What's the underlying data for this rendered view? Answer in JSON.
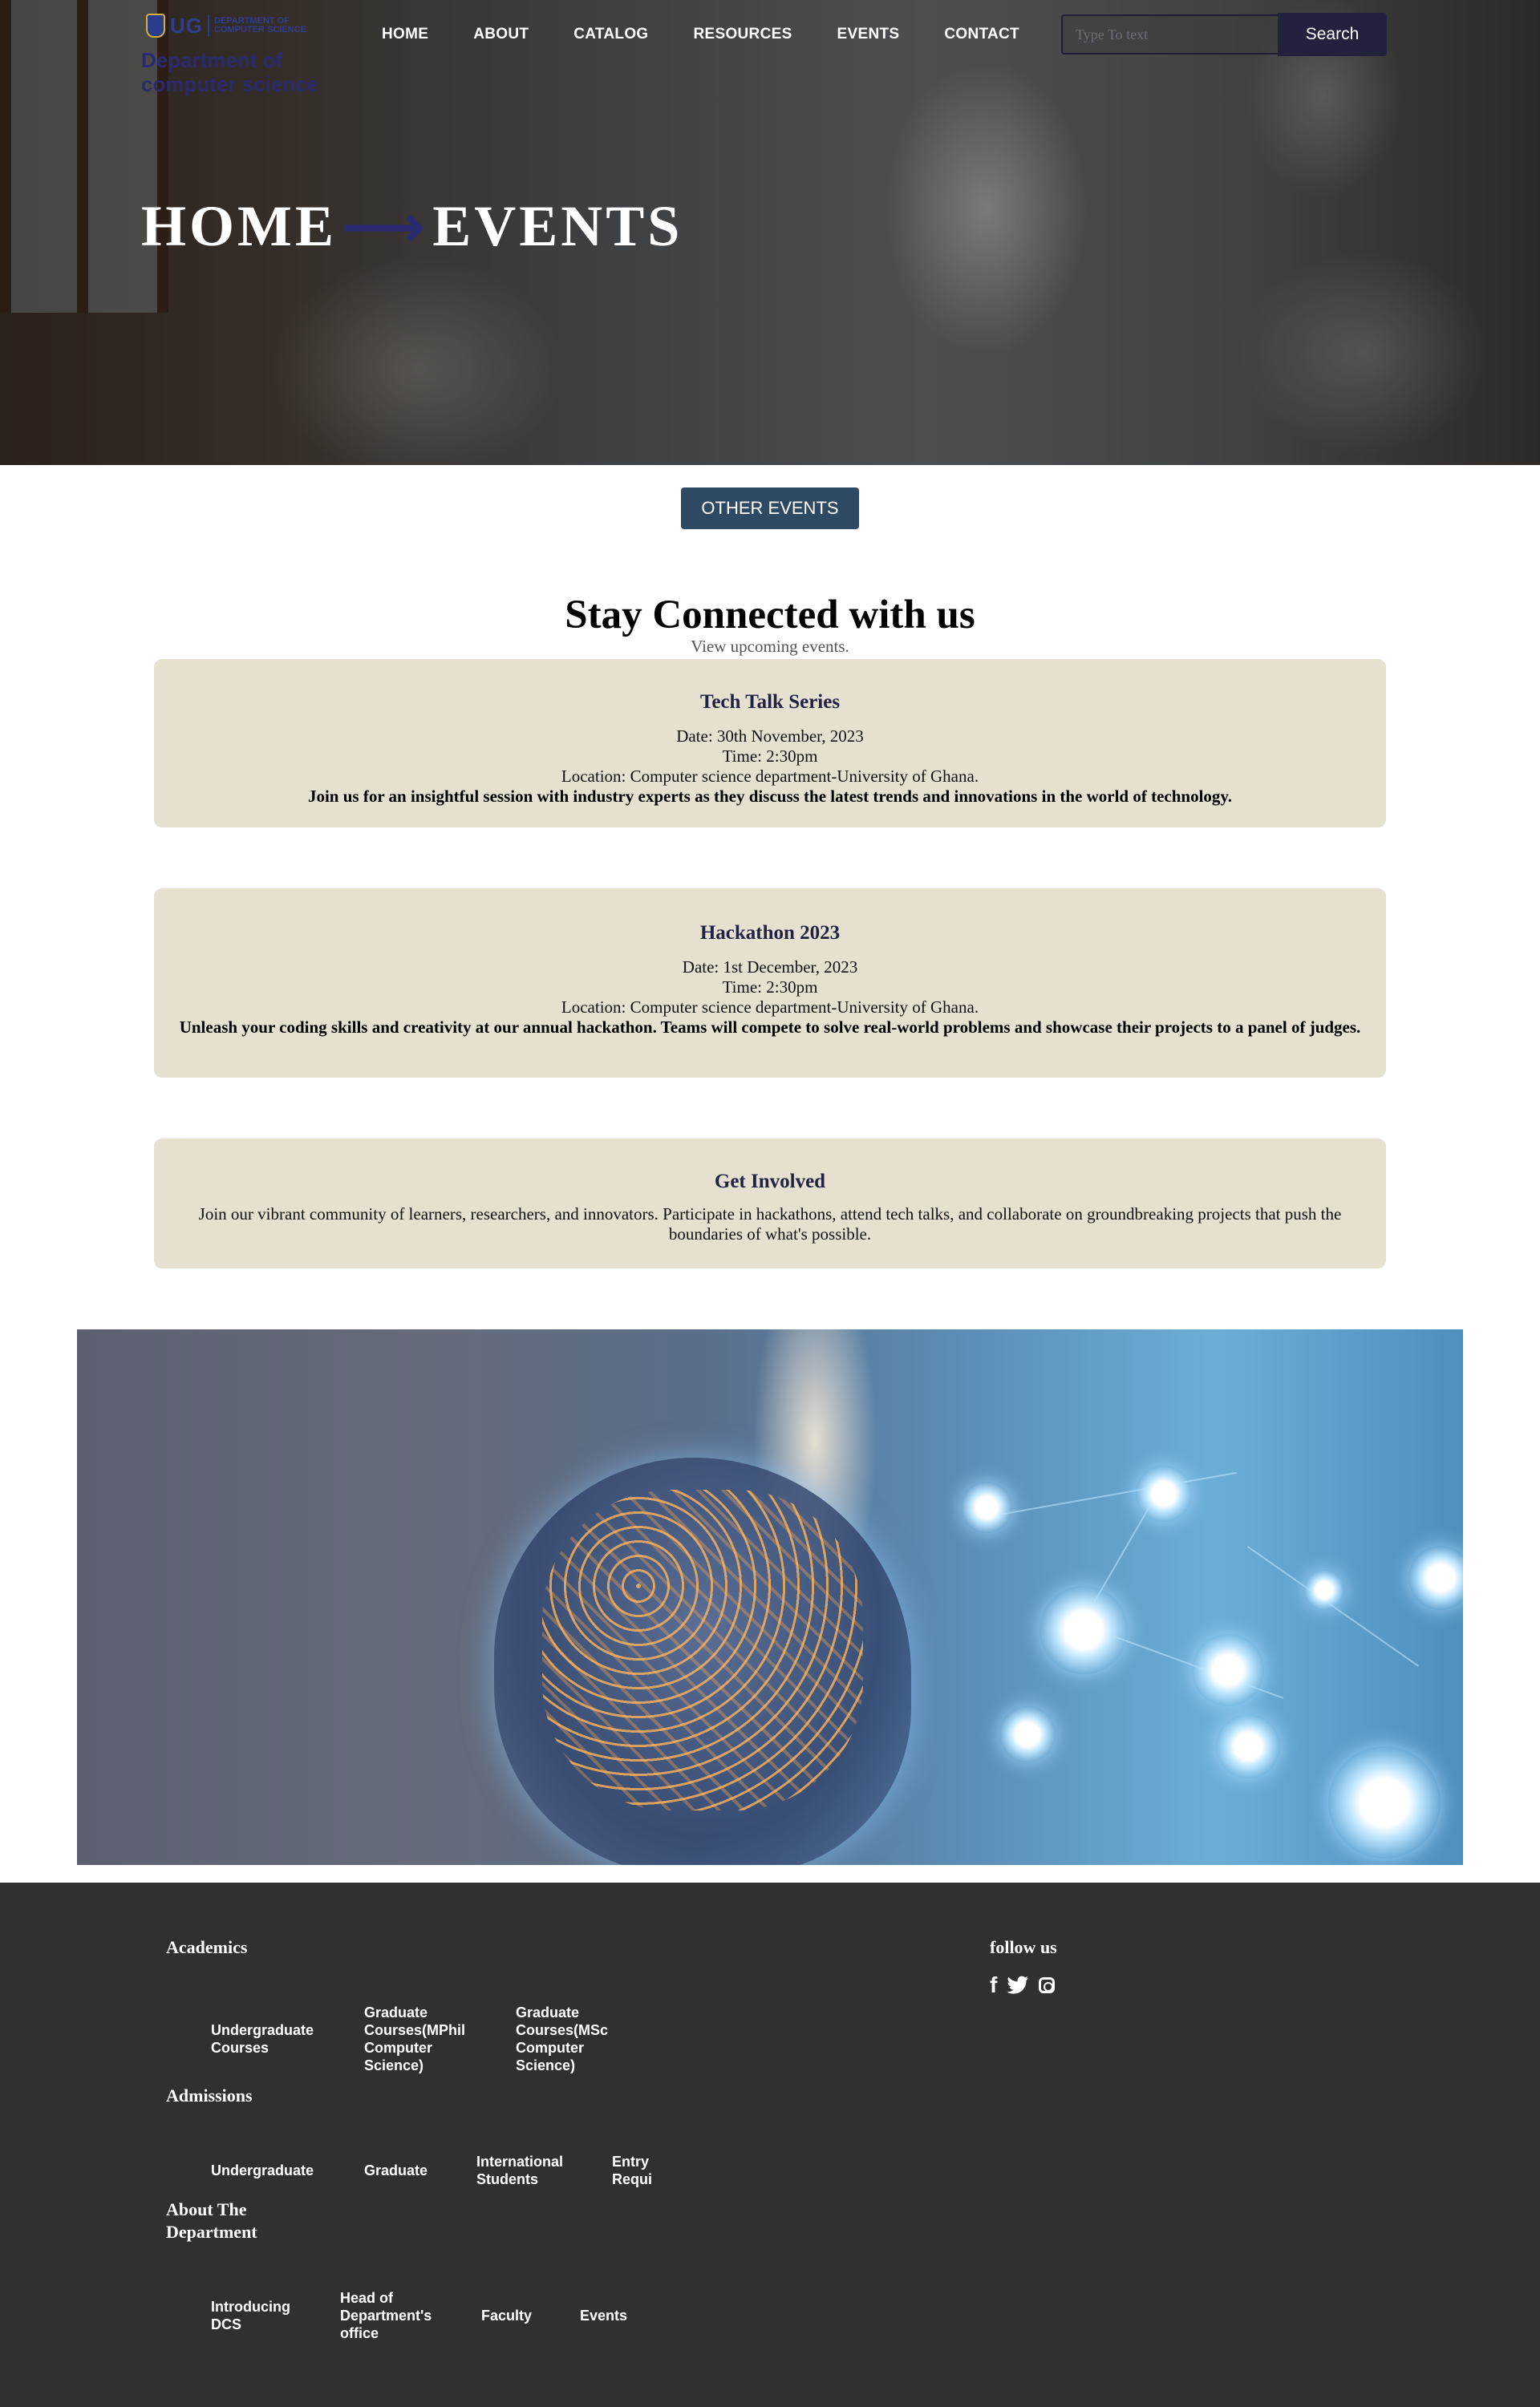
{
  "header": {
    "logo_short": "UG",
    "logo_text": "DEPARTMENT OF COMPUTER SCIENCE",
    "dept_name": "Department of computer science",
    "nav": [
      "HOME",
      "ABOUT",
      "CATALOG",
      "RESOURCES",
      "EVENTS",
      "CONTACT"
    ],
    "search": {
      "placeholder": "Type To text",
      "button": "Search"
    }
  },
  "hero": {
    "crumb_home": "HOME",
    "arrow": "⟶",
    "crumb_current": "EVENTS"
  },
  "other_events": "OTHER EVENTS",
  "connect": {
    "title": "Stay Connected with us",
    "subtitle": "View upcoming events."
  },
  "events": [
    {
      "title": "Tech Talk Series",
      "date": "Date: 30th November, 2023",
      "time": "Time: 2:30pm",
      "location": "Location: Computer science department-University of Ghana.",
      "description": "Join us for an insightful session with industry experts as they discuss the latest trends and innovations in the world of technology."
    },
    {
      "title": "Hackathon 2023",
      "date": "Date: 1st December, 2023",
      "time": "Time: 2:30pm",
      "location": "Location: Computer science department-University of Ghana.",
      "description": "Unleash your coding skills and creativity at our annual hackathon. Teams will compete to solve real-world problems and showcase their projects to a panel of judges."
    }
  ],
  "get_involved": {
    "title": "Get Involved",
    "text": "Join our vibrant community of learners, researchers, and innovators. Participate in hackathons, attend tech talks, and collaborate on groundbreaking projects that push the boundaries of what's possible."
  },
  "footer": {
    "academics": {
      "heading": "Academics",
      "links": [
        "Undergraduate Courses",
        "Graduate Courses(MPhil Computer Science)",
        "Graduate Courses(MSc Computer Science)"
      ]
    },
    "admissions": {
      "heading": "Admissions",
      "links": [
        "Undergraduate",
        "Graduate",
        "International Students",
        "Entry Requi"
      ]
    },
    "about": {
      "heading": "About The Department",
      "links": [
        "Introducing DCS",
        "Head of Department's office",
        "Faculty",
        "Events"
      ]
    },
    "follow": {
      "heading": "follow us",
      "icons": [
        "facebook-icon",
        "twitter-icon",
        "instagram-icon"
      ]
    }
  }
}
